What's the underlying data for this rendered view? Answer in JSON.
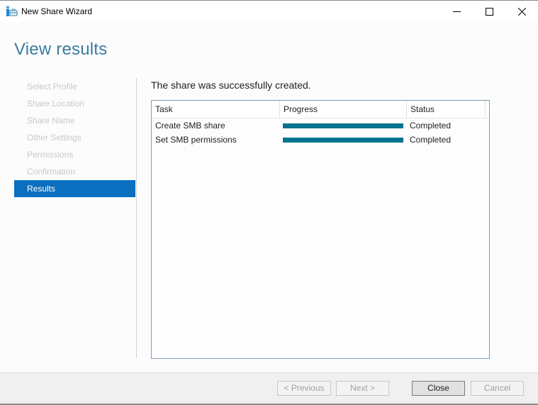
{
  "window": {
    "title": "New Share Wizard",
    "controls": [
      "minimize",
      "maximize",
      "close"
    ]
  },
  "page": {
    "heading": "View results",
    "result_message": "The share was successfully created."
  },
  "nav": {
    "items": [
      {
        "label": "Select Profile",
        "state": "disabled"
      },
      {
        "label": "Share Location",
        "state": "disabled"
      },
      {
        "label": "Share Name",
        "state": "disabled"
      },
      {
        "label": "Other Settings",
        "state": "disabled"
      },
      {
        "label": "Permissions",
        "state": "disabled"
      },
      {
        "label": "Confirmation",
        "state": "disabled"
      },
      {
        "label": "Results",
        "state": "active"
      }
    ]
  },
  "results_table": {
    "columns": [
      "Task",
      "Progress",
      "Status"
    ],
    "rows": [
      {
        "task": "Create SMB share",
        "progress_percent": 100,
        "status": "Completed"
      },
      {
        "task": "Set SMB permissions",
        "progress_percent": 100,
        "status": "Completed"
      }
    ]
  },
  "buttons": {
    "previous": "< Previous",
    "next": "Next >",
    "close": "Close",
    "cancel": "Cancel"
  },
  "colors": {
    "accent": "#0a6fbf",
    "heading": "#3d7a9e",
    "progress": "#04738f"
  }
}
